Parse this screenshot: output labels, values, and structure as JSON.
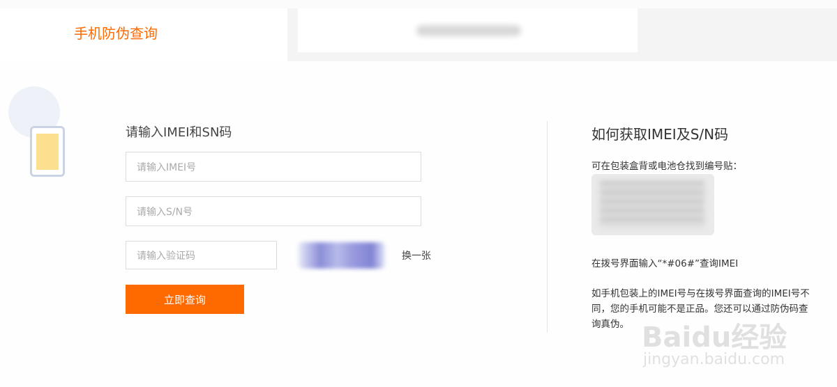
{
  "tabs": [
    {
      "label": "手机防伪查询",
      "active": true,
      "color": "#ff6a00"
    },
    {
      "label": "",
      "active": false
    }
  ],
  "form": {
    "title": "请输入IMEI和SN码",
    "imei_placeholder": "请输入IMEI号",
    "sn_placeholder": "请输入S/N号",
    "captcha_placeholder": "请输入验证码",
    "refresh_label": "换一张",
    "submit_label": "立即查询",
    "accent_color": "#ff6a00"
  },
  "help": {
    "title": "如何获取IMEI及S/N码",
    "label_hint": "可在包装盒背或电池仓找到编号贴：",
    "dial_hint": "在拨号界面输入“*#06#”查询IMEI",
    "warning": "如手机包装上的IMEI号与在拨号界面查询的IMEI号不同，您的手机可能不是正品。您还可以通过防伪码查询真伪。"
  },
  "watermark": {
    "logo": "Baidu经验",
    "url": "jingyan.baidu.com"
  },
  "icons": {
    "phone": "phone-icon"
  }
}
